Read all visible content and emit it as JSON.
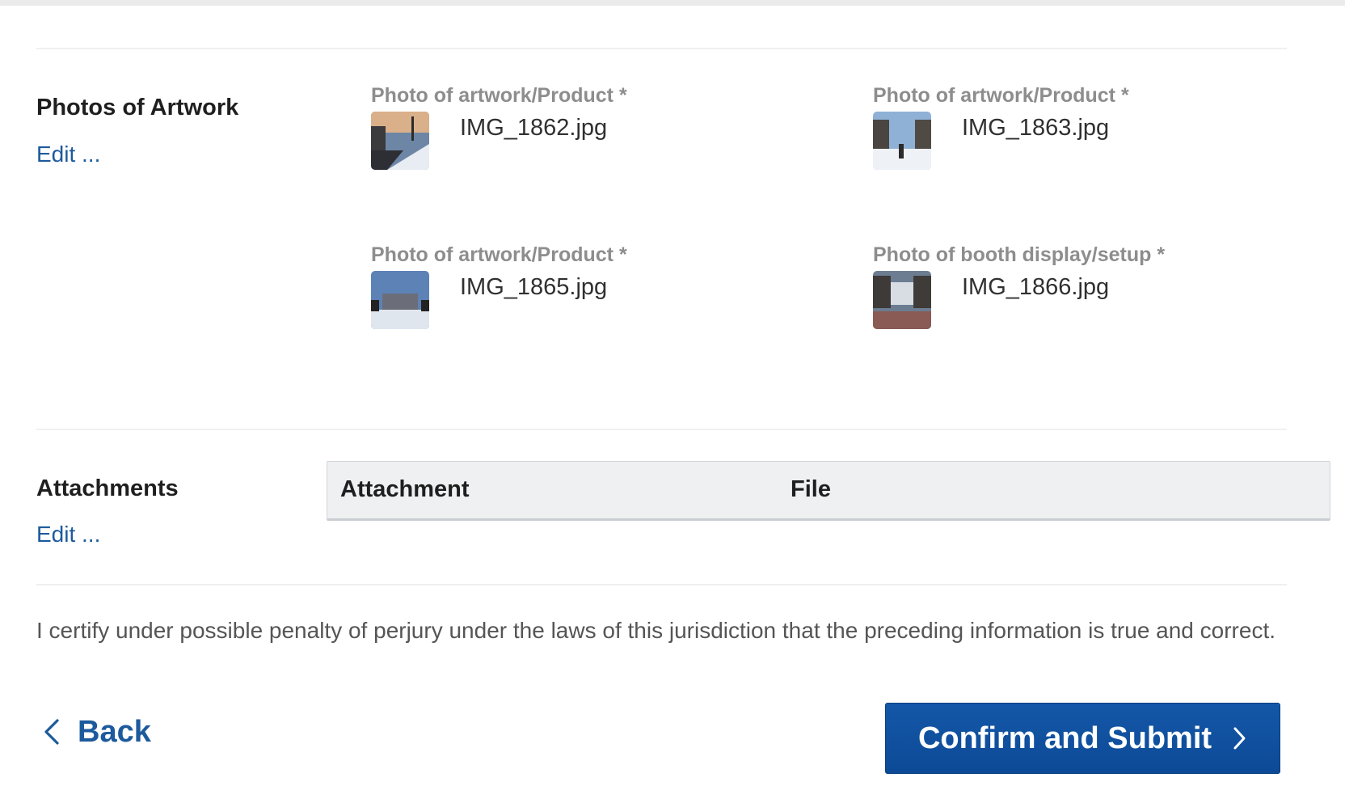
{
  "photos_section": {
    "title": "Photos of Artwork",
    "edit_label": "Edit ...",
    "photos": [
      {
        "label": "Photo of artwork/Product *",
        "filename": "IMG_1862.jpg"
      },
      {
        "label": "Photo of artwork/Product *",
        "filename": "IMG_1863.jpg"
      },
      {
        "label": "Photo of artwork/Product *",
        "filename": "IMG_1865.jpg"
      },
      {
        "label": "Photo of booth display/setup *",
        "filename": "IMG_1866.jpg"
      }
    ]
  },
  "attachments_section": {
    "title": "Attachments",
    "edit_label": "Edit ...",
    "columns": [
      "Attachment",
      "File"
    ]
  },
  "certification": {
    "text": "I certify under possible penalty of perjury under the laws of this jurisdiction that the preceding information is true and correct."
  },
  "actions": {
    "back_label": "Back",
    "submit_label": "Confirm and Submit"
  },
  "colors": {
    "link": "#1d5a9c",
    "primary_button": "#0c4a96",
    "label_gray": "#8d8d8d"
  }
}
